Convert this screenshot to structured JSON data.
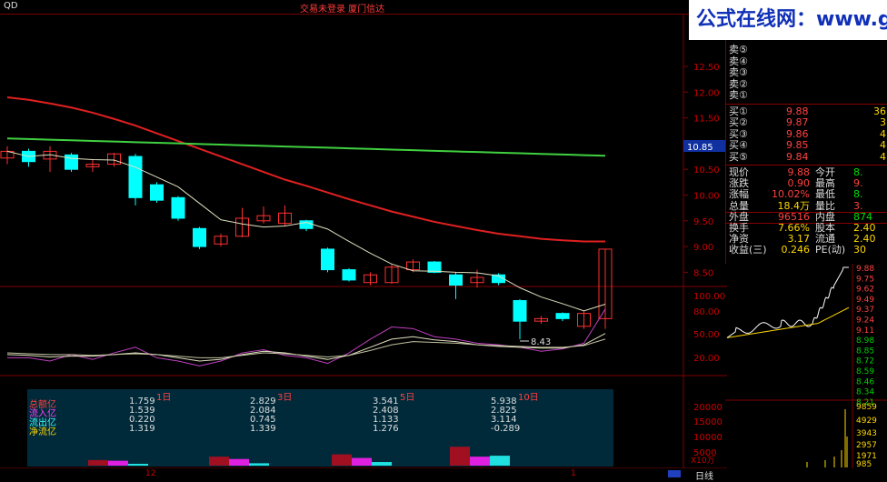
{
  "window": {
    "code": "QD",
    "title": "交易未登录  厦门信达",
    "right_tag": "5"
  },
  "watermark": "公式在线网：www.gszx.com.cn",
  "price_axis": [
    "12.50",
    "12.00",
    "11.50",
    "11.00",
    "10.50",
    "10.00",
    "9.50",
    "9.00",
    "8.50"
  ],
  "current_price_tag": "10.85",
  "low_marker": "8.43",
  "indicator_axis": [
    "100.00",
    "80.00",
    "50.00",
    "20.00"
  ],
  "volume_axis": [
    "20000",
    "15000",
    "10000",
    "5000"
  ],
  "volume_unit": "X10万",
  "bottom_axis": {
    "left": "12",
    "right": "1",
    "period": "日线"
  },
  "candles": [
    {
      "o": 10.72,
      "c": 10.85,
      "h": 10.95,
      "l": 10.6
    },
    {
      "o": 10.85,
      "c": 10.65,
      "h": 10.9,
      "l": 10.55
    },
    {
      "o": 10.7,
      "c": 10.85,
      "h": 10.95,
      "l": 10.45
    },
    {
      "o": 10.78,
      "c": 10.5,
      "h": 10.82,
      "l": 10.45
    },
    {
      "o": 10.55,
      "c": 10.6,
      "h": 10.7,
      "l": 10.45
    },
    {
      "o": 10.6,
      "c": 10.8,
      "h": 10.82,
      "l": 10.55
    },
    {
      "o": 10.75,
      "c": 9.95,
      "h": 10.8,
      "l": 9.8
    },
    {
      "o": 10.2,
      "c": 9.9,
      "h": 10.25,
      "l": 9.85
    },
    {
      "o": 9.95,
      "c": 9.55,
      "h": 9.98,
      "l": 9.5
    },
    {
      "o": 9.35,
      "c": 9.0,
      "h": 9.38,
      "l": 8.95
    },
    {
      "o": 9.05,
      "c": 9.2,
      "h": 9.25,
      "l": 9.0
    },
    {
      "o": 9.2,
      "c": 9.55,
      "h": 9.75,
      "l": 9.18
    },
    {
      "o": 9.5,
      "c": 9.6,
      "h": 9.78,
      "l": 9.45
    },
    {
      "o": 9.45,
      "c": 9.65,
      "h": 9.8,
      "l": 9.4
    },
    {
      "o": 9.5,
      "c": 9.35,
      "h": 9.52,
      "l": 9.3
    },
    {
      "o": 8.95,
      "c": 8.55,
      "h": 8.98,
      "l": 8.5
    },
    {
      "o": 8.55,
      "c": 8.35,
      "h": 8.58,
      "l": 8.32
    },
    {
      "o": 8.3,
      "c": 8.45,
      "h": 8.5,
      "l": 8.25
    },
    {
      "o": 8.3,
      "c": 8.6,
      "h": 8.65,
      "l": 8.28
    },
    {
      "o": 8.55,
      "c": 8.7,
      "h": 8.75,
      "l": 8.5
    },
    {
      "o": 8.7,
      "c": 8.5,
      "h": 8.72,
      "l": 8.48
    },
    {
      "o": 8.45,
      "c": 8.25,
      "h": 8.5,
      "l": 7.98
    },
    {
      "o": 8.3,
      "c": 8.4,
      "h": 8.55,
      "l": 8.2
    },
    {
      "o": 8.45,
      "c": 8.3,
      "h": 8.48,
      "l": 8.25
    },
    {
      "o": 7.95,
      "c": 7.55,
      "h": 7.98,
      "l": 7.2
    },
    {
      "o": 7.55,
      "c": 7.6,
      "h": 7.65,
      "l": 7.5
    },
    {
      "o": 7.7,
      "c": 7.6,
      "h": 7.72,
      "l": 7.55
    },
    {
      "o": 7.45,
      "c": 7.7,
      "h": 7.75,
      "l": 7.4
    },
    {
      "o": 7.6,
      "c": 8.95,
      "h": 8.95,
      "l": 7.4
    }
  ],
  "fund_table": {
    "periods": [
      "1日",
      "3日",
      "5日",
      "10日"
    ],
    "rows": [
      {
        "label": "总额亿",
        "color": "#ff4040",
        "values": [
          "1.759",
          "2.829",
          "3.541",
          "5.938"
        ]
      },
      {
        "label": "流入亿",
        "color": "#ff40ff",
        "values": [
          "1.539",
          "2.084",
          "2.408",
          "2.825"
        ]
      },
      {
        "label": "流出亿",
        "color": "#40ffff",
        "values": [
          "0.220",
          "0.745",
          "1.133",
          "3.114"
        ]
      },
      {
        "label": "净流亿",
        "color": "#ffd700",
        "values": [
          "1.319",
          "1.339",
          "1.276",
          "-0.289"
        ]
      }
    ]
  },
  "order_book": {
    "sell": [
      {
        "label": "卖⑤",
        "price": "",
        "vol": ""
      },
      {
        "label": "卖④",
        "price": "",
        "vol": ""
      },
      {
        "label": "卖③",
        "price": "",
        "vol": ""
      },
      {
        "label": "卖②",
        "price": "",
        "vol": ""
      },
      {
        "label": "卖①",
        "price": "",
        "vol": ""
      }
    ],
    "buy": [
      {
        "label": "买①",
        "price": "9.88",
        "vol": "36"
      },
      {
        "label": "买②",
        "price": "9.87",
        "vol": "3"
      },
      {
        "label": "买③",
        "price": "9.86",
        "vol": "4"
      },
      {
        "label": "买④",
        "price": "9.85",
        "vol": "4"
      },
      {
        "label": "买⑤",
        "price": "9.84",
        "vol": "4"
      }
    ]
  },
  "stats": [
    {
      "l1": "现价",
      "v1": "9.88",
      "c1": "red",
      "l2": "今开",
      "v2": "8.",
      "c2": "grn"
    },
    {
      "l1": "涨跌",
      "v1": "0.90",
      "c1": "red",
      "l2": "最高",
      "v2": "9.",
      "c2": "red"
    },
    {
      "l1": "涨幅",
      "v1": "10.02%",
      "c1": "red",
      "l2": "最低",
      "v2": "8.",
      "c2": "grn"
    },
    {
      "l1": "总量",
      "v1": "18.4万",
      "c1": "yel",
      "l2": "量比",
      "v2": "3.",
      "c2": "red"
    },
    {
      "l1": "外盘",
      "v1": "96516",
      "c1": "red",
      "l2": "内盘",
      "v2": "874",
      "c2": "grn"
    },
    {
      "l1": "换手",
      "v1": "7.66%",
      "c1": "yel",
      "l2": "股本",
      "v2": "2.40",
      "c2": "yel"
    },
    {
      "l1": "净资",
      "v1": "3.17",
      "c1": "yel",
      "l2": "流通",
      "v2": "2.40",
      "c2": "yel"
    },
    {
      "l1": "收益(三)",
      "v1": "0.246",
      "c1": "yel",
      "l2": "PE(动)",
      "v2": "30",
      "c2": "yel"
    }
  ],
  "mini_price_axis": [
    "9.88",
    "9.75",
    "9.62",
    "9.49",
    "9.37",
    "9.24",
    "9.11",
    "8.98",
    "8.85",
    "8.72",
    "8.59",
    "8.46",
    "8.34",
    "8.21"
  ],
  "mini_vol_axis": [
    "9859",
    "4929",
    "3943",
    "2957",
    "1971",
    "985"
  ],
  "colors": {
    "up": "#ff3030",
    "down": "#00ffff",
    "ma_red": "#e02020",
    "ma_green": "#40d040",
    "ma_white": "#e0e0c0",
    "grid": "#800000"
  }
}
